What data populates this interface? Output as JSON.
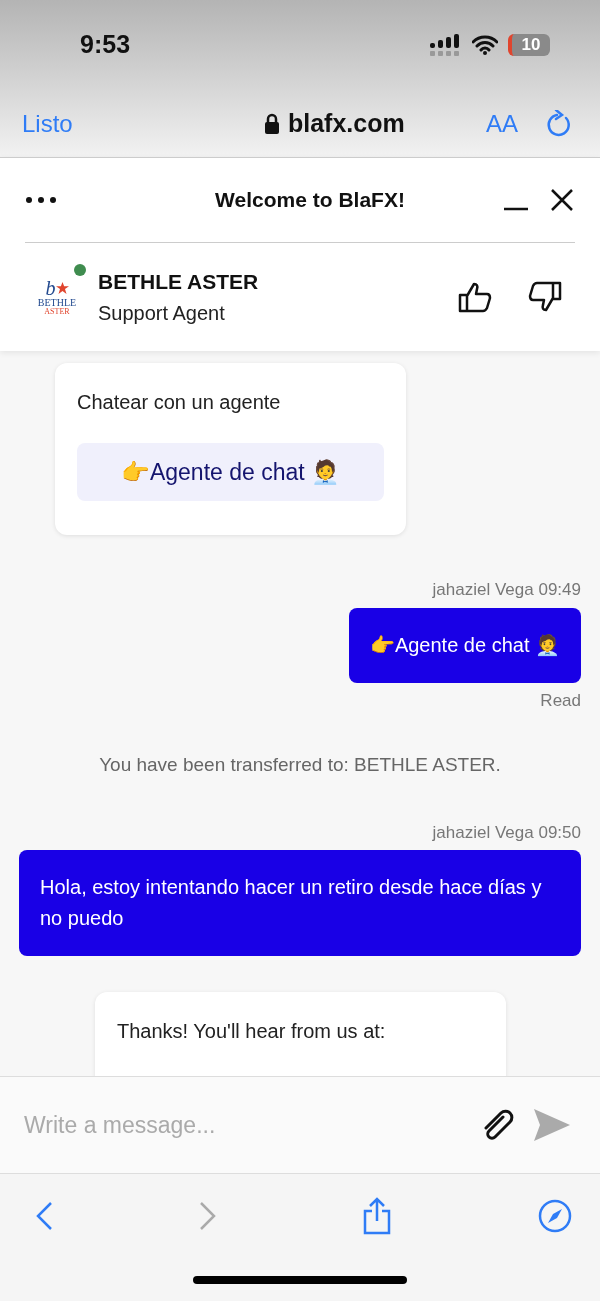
{
  "status_bar": {
    "time": "9:53",
    "battery": "10"
  },
  "browser_bar": {
    "done": "Listo",
    "url": "blafx.com",
    "text_size": "AA"
  },
  "chat_header": {
    "title": "Welcome to BlaFX!"
  },
  "agent": {
    "logo_letter": "b",
    "logo_name": "BETHLE",
    "logo_sub": "ASTER",
    "name": "BETHLE ASTER",
    "role": "Support Agent",
    "online": true
  },
  "messages": [
    {
      "kind": "bot_card",
      "text": "Chatear con un agente",
      "button": "👉Agente de chat 🧑‍💼"
    },
    {
      "kind": "user",
      "meta": "jahaziel Vega 09:49",
      "text": "👉Agente de chat 🧑‍💼",
      "receipt": "Read"
    },
    {
      "kind": "system",
      "text": "You have been transferred to: BETHLE ASTER."
    },
    {
      "kind": "user",
      "meta": "jahaziel Vega 09:50",
      "text": "Hola, estoy intentando hacer un retiro desde hace días y no puedo"
    },
    {
      "kind": "bot_card",
      "text": "Thanks! You'll hear from us at:"
    }
  ],
  "composer": {
    "placeholder": "Write a message..."
  }
}
